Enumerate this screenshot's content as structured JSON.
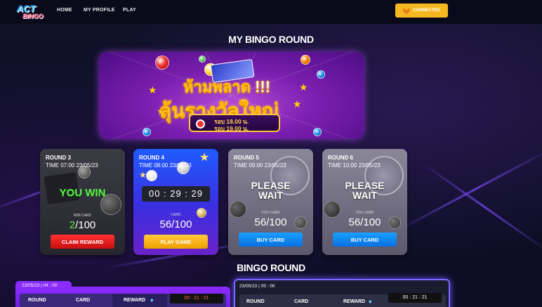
{
  "nav": {
    "logo_top": "ACT",
    "logo_bottom": "BINGO",
    "links": [
      "HOME",
      "MY PROFILE",
      "PLAY"
    ],
    "wallet_label": "CONNECTED"
  },
  "my_round_title": "MY BINGO ROUND",
  "banner": {
    "line1": "ห้ามพลาด !!!",
    "line2": "ลุ้นรางวัลใหญ่",
    "time1": "รอบ 18.00 น.",
    "time2": "รอบ 19.00 น."
  },
  "rounds": [
    {
      "title": "ROUND 3",
      "time": "TIME 07:00 23/05/23",
      "status": "YOU WIN",
      "card_label": "WIN CARD",
      "count_hl": "2",
      "count_rest": "/100",
      "button": "CLAIM REWARD"
    },
    {
      "title": "ROUND 4",
      "time": "TIME 08:00 23/05/23",
      "timer": "00 : 29 : 29",
      "card_label": "CARD",
      "count": "56/100",
      "button": "PLAY GAME"
    },
    {
      "title": "ROUND 5",
      "time": "TIME 09:00 23/05/23",
      "status1": "PLEASE",
      "status2": "WAIT",
      "card_label": "YOU CARD",
      "count": "56/100",
      "button": "BUY CARD"
    },
    {
      "title": "ROUND 6",
      "time": "TIME 10:00 23/05/23",
      "status1": "PLEASE",
      "status2": "WAIT",
      "card_label": "YOU CARD",
      "count": "56/100",
      "button": "BUY CARD"
    }
  ],
  "bingo_round_title": "BINGO ROUND",
  "bingo_panels": [
    {
      "date": "23/05/23 | 04 : 00",
      "headers": [
        "ROUND",
        "CARD",
        "REWARD"
      ],
      "timer": "00 : 21 : 21"
    },
    {
      "date": "23/05/23 | 05 : 00",
      "headers": [
        "ROUND",
        "CARD",
        "REWARD"
      ],
      "timer": "00 : 21 : 21"
    }
  ],
  "colors": {
    "accent": "#f5b820",
    "win_green": "#5af04a",
    "purple": "#8a2cff"
  }
}
